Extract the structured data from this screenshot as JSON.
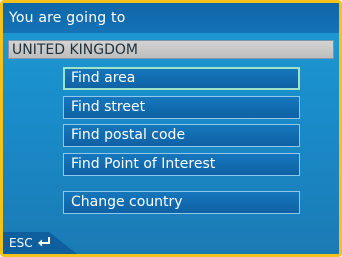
{
  "header": {
    "title": "You are going to"
  },
  "country_field": {
    "value": "UNITED KINGDOM"
  },
  "menu": {
    "items": [
      {
        "label": "Find area",
        "selected": true
      },
      {
        "label": "Find street",
        "selected": false
      },
      {
        "label": "Find postal code",
        "selected": false
      },
      {
        "label": "Find Point of Interest",
        "selected": false
      },
      {
        "label": "Change country",
        "selected": false
      }
    ]
  },
  "footer": {
    "esc_label": "ESC",
    "esc_icon": "return-arrow-icon"
  },
  "colors": {
    "frame": "#f4c21a",
    "background": "#1a8fcc",
    "titlebar": "#0e67a8",
    "button": "#1577bd",
    "selected_border": "#9de2c9"
  }
}
